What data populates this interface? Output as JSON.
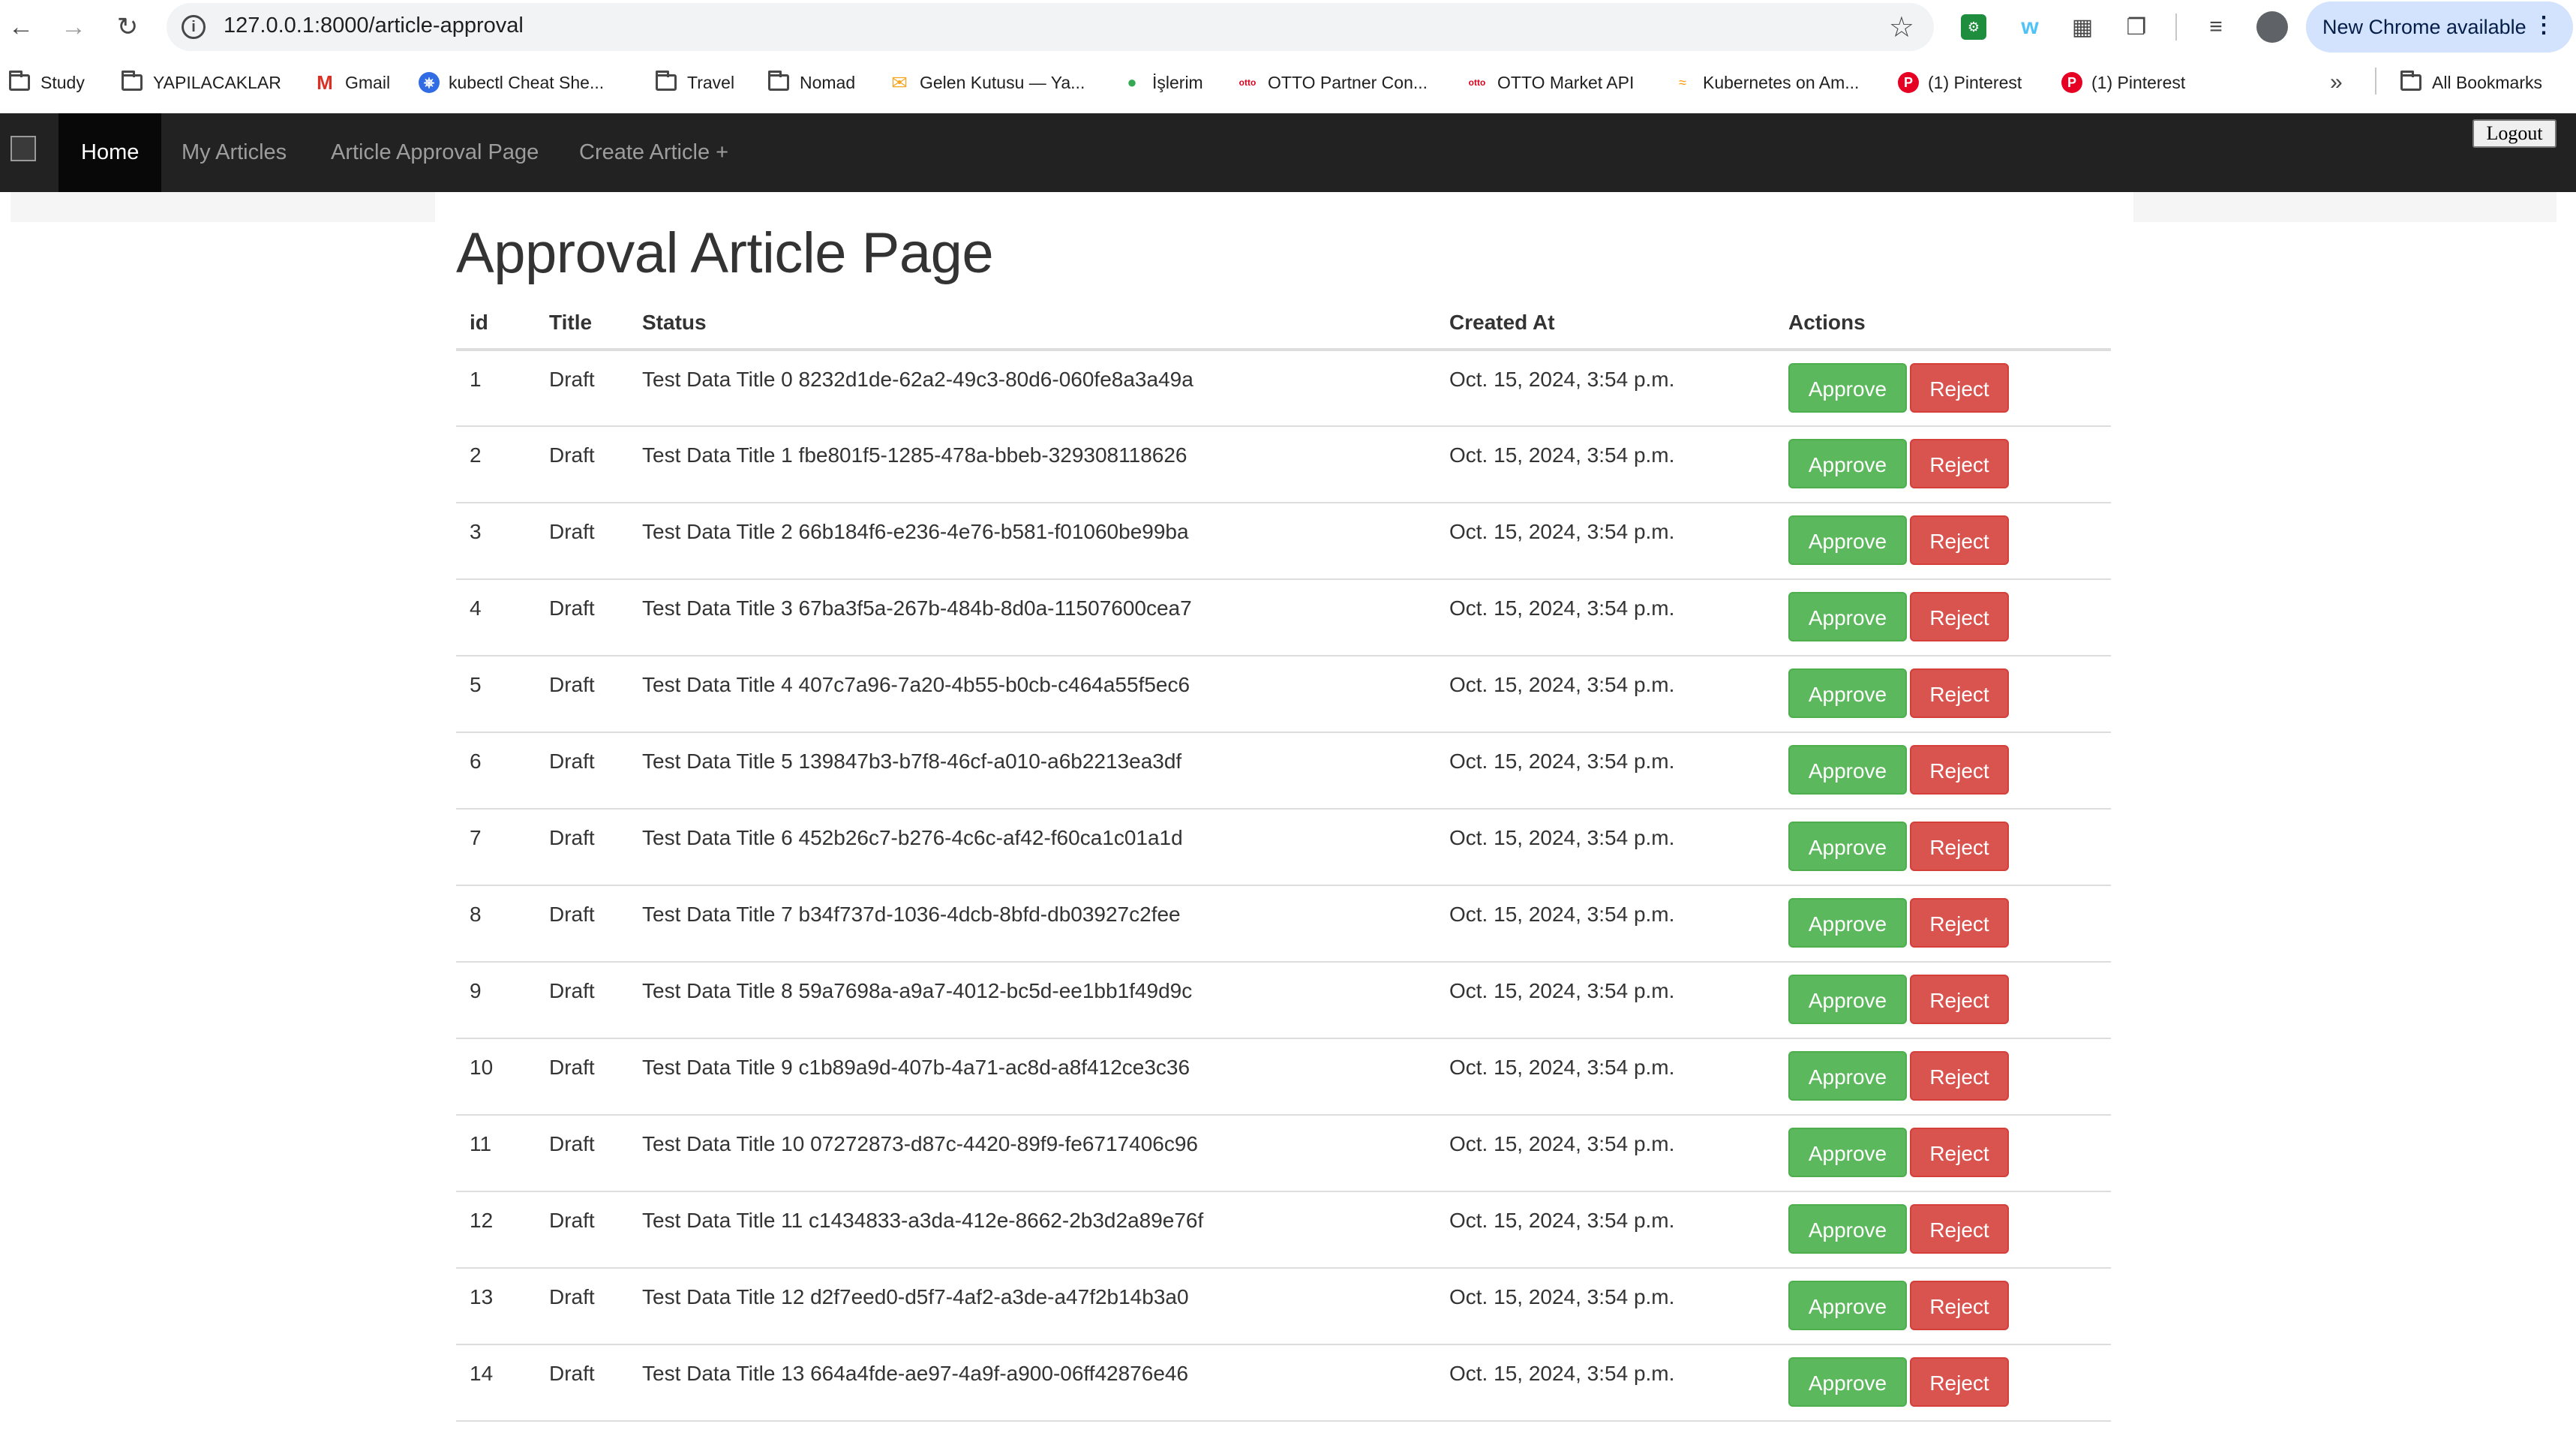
{
  "browser": {
    "url": "127.0.0.1:8000/article-approval",
    "new_chrome_label": "New Chrome available",
    "bookmarks": [
      {
        "label": "Study",
        "icon": "folder-icon"
      },
      {
        "label": "YAPILACAKLAR",
        "icon": "folder-icon"
      },
      {
        "label": "Gmail",
        "icon": "gmail-icon"
      },
      {
        "label": "kubectl Cheat She...",
        "icon": "kubernetes-icon"
      },
      {
        "label": "Travel",
        "icon": "folder-icon"
      },
      {
        "label": "Nomad",
        "icon": "folder-icon"
      },
      {
        "label": "Gelen Kutusu — Ya...",
        "icon": "mail-icon"
      },
      {
        "label": "İşlerim",
        "icon": "drop-icon"
      },
      {
        "label": "OTTO Partner Con...",
        "icon": "otto-icon"
      },
      {
        "label": "OTTO Market API",
        "icon": "otto-icon"
      },
      {
        "label": "Kubernetes on Am...",
        "icon": "aws-icon"
      },
      {
        "label": "(1) Pinterest",
        "icon": "pinterest-icon"
      },
      {
        "label": "(1) Pinterest",
        "icon": "pinterest-icon"
      }
    ],
    "all_bookmarks_label": "All Bookmarks"
  },
  "navbar": {
    "home": "Home",
    "my_articles": "My Articles",
    "article_approval": "Article Approval Page",
    "create_article": "Create Article +",
    "logout": "Logout"
  },
  "page": {
    "title": "Approval Article Page",
    "columns": [
      "id",
      "Title",
      "Status",
      "Created At",
      "Actions"
    ],
    "approve_label": "Approve",
    "reject_label": "Reject",
    "rows": [
      {
        "id": "1",
        "title": "Draft",
        "status": "Test Data Title 0 8232d1de-62a2-49c3-80d6-060fe8a3a49a",
        "created_at": "Oct. 15, 2024, 3:54 p.m."
      },
      {
        "id": "2",
        "title": "Draft",
        "status": "Test Data Title 1 fbe801f5-1285-478a-bbeb-329308118626",
        "created_at": "Oct. 15, 2024, 3:54 p.m."
      },
      {
        "id": "3",
        "title": "Draft",
        "status": "Test Data Title 2 66b184f6-e236-4e76-b581-f01060be99ba",
        "created_at": "Oct. 15, 2024, 3:54 p.m."
      },
      {
        "id": "4",
        "title": "Draft",
        "status": "Test Data Title 3 67ba3f5a-267b-484b-8d0a-11507600cea7",
        "created_at": "Oct. 15, 2024, 3:54 p.m."
      },
      {
        "id": "5",
        "title": "Draft",
        "status": "Test Data Title 4 407c7a96-7a20-4b55-b0cb-c464a55f5ec6",
        "created_at": "Oct. 15, 2024, 3:54 p.m."
      },
      {
        "id": "6",
        "title": "Draft",
        "status": "Test Data Title 5 139847b3-b7f8-46cf-a010-a6b2213ea3df",
        "created_at": "Oct. 15, 2024, 3:54 p.m."
      },
      {
        "id": "7",
        "title": "Draft",
        "status": "Test Data Title 6 452b26c7-b276-4c6c-af42-f60ca1c01a1d",
        "created_at": "Oct. 15, 2024, 3:54 p.m."
      },
      {
        "id": "8",
        "title": "Draft",
        "status": "Test Data Title 7 b34f737d-1036-4dcb-8bfd-db03927c2fee",
        "created_at": "Oct. 15, 2024, 3:54 p.m."
      },
      {
        "id": "9",
        "title": "Draft",
        "status": "Test Data Title 8 59a7698a-a9a7-4012-bc5d-ee1bb1f49d9c",
        "created_at": "Oct. 15, 2024, 3:54 p.m."
      },
      {
        "id": "10",
        "title": "Draft",
        "status": "Test Data Title 9 c1b89a9d-407b-4a71-ac8d-a8f412ce3c36",
        "created_at": "Oct. 15, 2024, 3:54 p.m."
      },
      {
        "id": "11",
        "title": "Draft",
        "status": "Test Data Title 10 07272873-d87c-4420-89f9-fe6717406c96",
        "created_at": "Oct. 15, 2024, 3:54 p.m."
      },
      {
        "id": "12",
        "title": "Draft",
        "status": "Test Data Title 11 c1434833-a3da-412e-8662-2b3d2a89e76f",
        "created_at": "Oct. 15, 2024, 3:54 p.m."
      },
      {
        "id": "13",
        "title": "Draft",
        "status": "Test Data Title 12 d2f7eed0-d5f7-4af2-a3de-a47f2b14b3a0",
        "created_at": "Oct. 15, 2024, 3:54 p.m."
      },
      {
        "id": "14",
        "title": "Draft",
        "status": "Test Data Title 13 664a4fde-ae97-4a9f-a900-06ff42876e46",
        "created_at": "Oct. 15, 2024, 3:54 p.m."
      }
    ]
  },
  "colors": {
    "approve": "#5cb85c",
    "reject": "#d9534f",
    "navbar": "#222222"
  }
}
